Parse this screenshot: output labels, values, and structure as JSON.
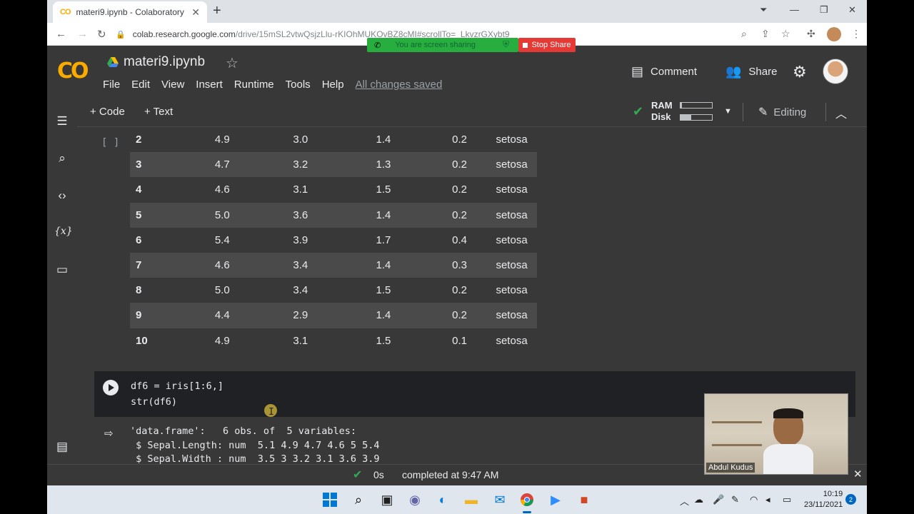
{
  "browser": {
    "tab_title": "materi9.ipynb - Colaboratory",
    "url_main": "colab.research.google.com",
    "url_rest": "/drive/15mSL2vtwQsjzLlu-rKIOhMUKOvBZ8cMI#scrollTo=_LkvzrGXybt9",
    "screen_sharing_text": "You are screen sharing",
    "stop_share_label": "Stop Share"
  },
  "colab": {
    "logo": "CO",
    "notebook_title": "materi9.ipynb",
    "menu": [
      "File",
      "Edit",
      "View",
      "Insert",
      "Runtime",
      "Tools",
      "Help"
    ],
    "save_status": "All changes saved",
    "comment_label": "Comment",
    "share_label": "Share"
  },
  "toolbar": {
    "add_code_label": "+ Code",
    "add_text_label": "+ Text",
    "ram_label": "RAM",
    "disk_label": "Disk",
    "ram_usage": 0.05,
    "disk_usage": 0.35,
    "editing_label": "Editing"
  },
  "output_table": {
    "cell_brackets": "[ ]",
    "rows": [
      {
        "idx": "2",
        "sl": "4.9",
        "sw": "3.0",
        "pl": "1.4",
        "pw": "0.2",
        "species": "setosa"
      },
      {
        "idx": "3",
        "sl": "4.7",
        "sw": "3.2",
        "pl": "1.3",
        "pw": "0.2",
        "species": "setosa"
      },
      {
        "idx": "4",
        "sl": "4.6",
        "sw": "3.1",
        "pl": "1.5",
        "pw": "0.2",
        "species": "setosa"
      },
      {
        "idx": "5",
        "sl": "5.0",
        "sw": "3.6",
        "pl": "1.4",
        "pw": "0.2",
        "species": "setosa"
      },
      {
        "idx": "6",
        "sl": "5.4",
        "sw": "3.9",
        "pl": "1.7",
        "pw": "0.4",
        "species": "setosa"
      },
      {
        "idx": "7",
        "sl": "4.6",
        "sw": "3.4",
        "pl": "1.4",
        "pw": "0.3",
        "species": "setosa"
      },
      {
        "idx": "8",
        "sl": "5.0",
        "sw": "3.4",
        "pl": "1.5",
        "pw": "0.2",
        "species": "setosa"
      },
      {
        "idx": "9",
        "sl": "4.4",
        "sw": "2.9",
        "pl": "1.4",
        "pw": "0.2",
        "species": "setosa"
      },
      {
        "idx": "10",
        "sl": "4.9",
        "sw": "3.1",
        "pl": "1.5",
        "pw": "0.1",
        "species": "setosa"
      }
    ]
  },
  "code_cell": {
    "line1": "df6 = iris[1:6,]",
    "line2": "str(df6)"
  },
  "code_output": {
    "line1": "'data.frame':   6 obs. of  5 variables:",
    "line2": " $ Sepal.Length: num  5.1 4.9 4.7 4.6 5 5.4",
    "line3": " $ Sepal.Width : num  3.5 3 3.2 3.1 3.6 3.9"
  },
  "statusbar": {
    "duration": "0s",
    "completed_text": "completed at 9:47 AM"
  },
  "webcam": {
    "name": "Abdul Kudus"
  },
  "taskbar": {
    "time": "10:19",
    "date": "23/11/2021",
    "notification_count": "2"
  }
}
